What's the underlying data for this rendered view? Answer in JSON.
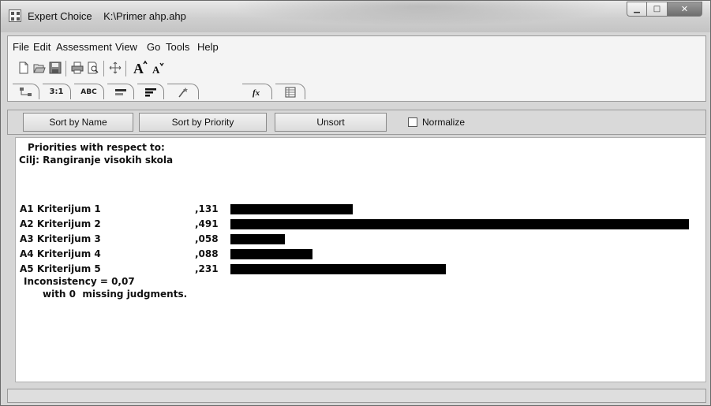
{
  "window": {
    "app_name": "Expert Choice",
    "file_path": "K:\\Primer ahp.ahp"
  },
  "menu": [
    "File",
    "Edit",
    "Assessment",
    "View",
    "Go",
    "Tools",
    "Help"
  ],
  "toolbar_icons": [
    "new-file-icon",
    "open-folder-icon",
    "save-icon",
    "print-icon",
    "print-preview-icon",
    "move-icon",
    "increase-font-icon",
    "decrease-font-icon"
  ],
  "tabs": [
    {
      "icon": "tree-icon",
      "label": ""
    },
    {
      "icon": "",
      "label": "3:1"
    },
    {
      "icon": "",
      "label": "ABC"
    },
    {
      "icon": "equal-lines-icon",
      "label": ""
    },
    {
      "icon": "bars-icon",
      "label": ""
    },
    {
      "icon": "wand-icon",
      "label": ""
    },
    {
      "icon": "formula-fx-icon",
      "label": ""
    },
    {
      "icon": "table-grid-icon",
      "label": ""
    }
  ],
  "sortbar": {
    "sort_name": "Sort by Name",
    "sort_priority": "Sort by Priority",
    "unsort": "Unsort",
    "normalize": "Normalize",
    "normalize_checked": false
  },
  "content": {
    "heading": "Priorities with respect to:",
    "goal": "Cilj: Rangiranje visokih skola",
    "inconsistency": "Inconsistency = 0,07",
    "missing": "with 0  missing judgments."
  },
  "priorities": [
    {
      "label": "A1 Kriterijum 1",
      "value": ",131",
      "priority": 0.131
    },
    {
      "label": "A2 Kriterijum 2",
      "value": ",491",
      "priority": 0.491
    },
    {
      "label": "A3 Kriterijum 3",
      "value": ",058",
      "priority": 0.058
    },
    {
      "label": "A4 Kriterijum 4",
      "value": ",088",
      "priority": 0.088
    },
    {
      "label": "A5 Kriterijum 5",
      "value": ",231",
      "priority": 0.231
    }
  ]
}
